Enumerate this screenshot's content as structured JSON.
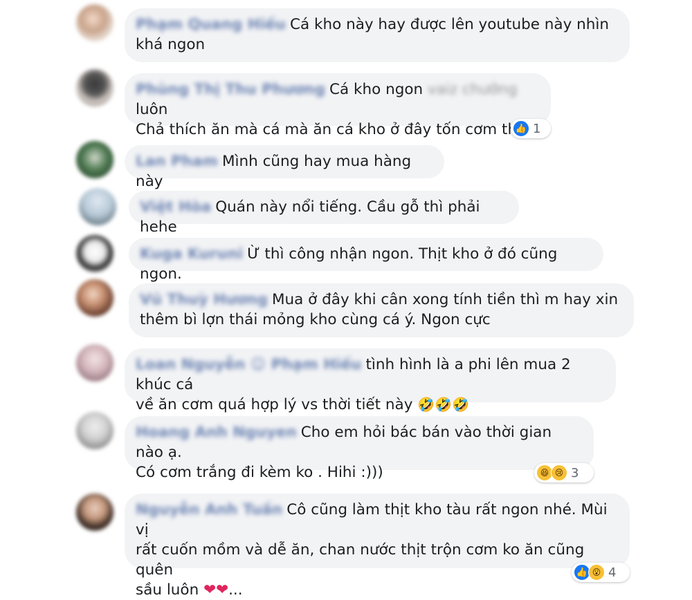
{
  "comments": [
    {
      "name": "Phạm Quang Hiếu",
      "lines": [
        "Cá kho này hay được lên youtube này nhìn",
        "khá ngon"
      ]
    },
    {
      "name": "Phùng Thị Thu Phương",
      "line1_start": "Cá kho ngon",
      "line1_hidden": "vaiz chưởng",
      "line1_end": "luôn",
      "line2": "Chả thích ăn mà cá mà ăn cá kho ở đây tốn cơm thật",
      "reaction_count": "1"
    },
    {
      "name": "Lan Pham",
      "lines": [
        "Mình cũng hay mua hàng này"
      ]
    },
    {
      "name": "Việt Hòa",
      "lines": [
        "Quán này nổi tiếng. Cầu gỗ thì phải hehe"
      ]
    },
    {
      "name": "Kuga Kuruni",
      "lines": [
        "Ừ thì công nhận ngon. Thịt kho ở đó cũng ngon."
      ]
    },
    {
      "name": "Vũ Thuỳ Hương",
      "lines": [
        "Mua ở đây khi cân xong tính tiền thì m hay xin",
        "thêm bì lợn thái mỏng kho cùng cá ý. Ngon cực"
      ]
    },
    {
      "name": "Loan Nguyễn ☺ Phạm Hiếu",
      "lines": [
        "tình hình là a phi lên mua 2 khúc cá",
        "về ăn cơm quá hợp lý vs thời tiết này"
      ],
      "emojis": "🤣🤣🤣"
    },
    {
      "name": "Hoang Anh Nguyen",
      "lines": [
        "Cho em hỏi bác bán vào thời gian nào ạ.",
        "Có cơm trắng đi kèm ko . Hihi :)))"
      ],
      "reaction_count": "3"
    },
    {
      "name": "Nguyễn Anh Tuấn",
      "lines": [
        "Cô cũng làm thịt kho tàu rất ngon nhé. Mùi vị",
        "rất cuốn mồm và dễ ăn, chan nước thịt trộn cơm ko ăn cũng quên",
        "sầu luôn"
      ],
      "hearts": "❤❤",
      "trailing": "...",
      "reaction_count": "4"
    }
  ],
  "icons": {
    "like": "like-icon",
    "haha": "haha-icon",
    "sad": "sad-icon",
    "wow": "wow-icon"
  },
  "colors": {
    "bubble": "#f2f3f5",
    "name": "#385898",
    "like": "#1877f2",
    "reaction_yellow": "#f7c035"
  }
}
